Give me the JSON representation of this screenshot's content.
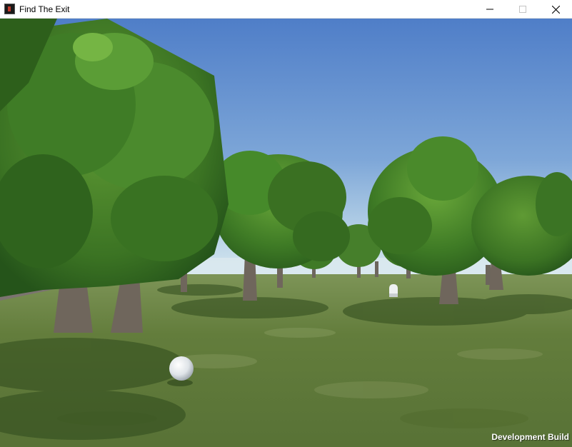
{
  "window": {
    "title": "Find The Exit",
    "icon": "unity-app-icon",
    "controls": [
      "minimize-icon",
      "maximize-icon",
      "close-icon"
    ]
  },
  "game": {
    "overlay_label": "Development Build",
    "colors": {
      "sky_top": "#4f7ec8",
      "sky_horizon": "#d2e4ee",
      "grass": "#5f7a3a",
      "foliage": "#3f7a26",
      "trunk": "#6f665c",
      "ball": "#e8ecef"
    }
  }
}
